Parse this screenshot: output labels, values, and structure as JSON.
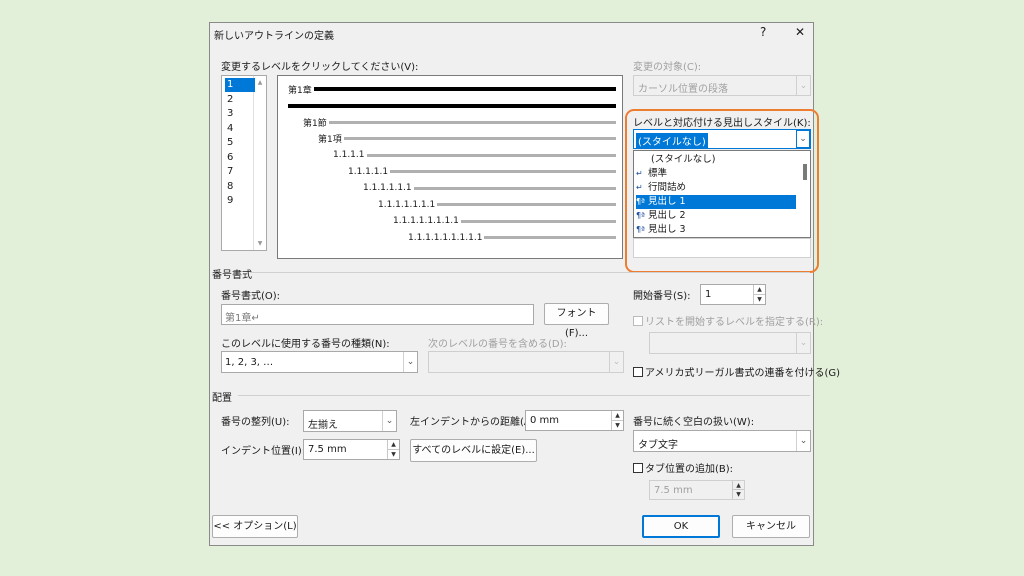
{
  "dialog": {
    "title": "新しいアウトラインの定義",
    "help_glyph": "?",
    "close_glyph": "✕"
  },
  "level_section": {
    "label": "変更するレベルをクリックしてください(V):",
    "levels": [
      "1",
      "2",
      "3",
      "4",
      "5",
      "6",
      "7",
      "8",
      "9"
    ],
    "selected": "1"
  },
  "preview": {
    "lines": [
      {
        "text": "第1章",
        "style": "thick"
      },
      {
        "text": "",
        "style": "thick"
      },
      {
        "text": "第1節",
        "style": "thin"
      },
      {
        "text": "第1項",
        "style": "thin"
      },
      {
        "text": "1.1.1.1",
        "style": "thin"
      },
      {
        "text": "1.1.1.1.1",
        "style": "thin"
      },
      {
        "text": "1.1.1.1.1.1",
        "style": "thin"
      },
      {
        "text": "1.1.1.1.1.1.1",
        "style": "thin"
      },
      {
        "text": "1.1.1.1.1.1.1.1",
        "style": "thin"
      },
      {
        "text": "1.1.1.1.1.1.1.1.1",
        "style": "thin"
      }
    ]
  },
  "apply_to": {
    "label": "変更の対象(C):",
    "value": "カーソル位置の段落"
  },
  "heading_style": {
    "label": "レベルと対応付ける見出しスタイル(K):",
    "value": "(スタイルなし)",
    "options": [
      {
        "icon": "",
        "text": "(スタイルなし)",
        "selected": false
      },
      {
        "icon": "↵",
        "text": "標準",
        "selected": false
      },
      {
        "icon": "↵",
        "text": "行間詰め",
        "selected": false
      },
      {
        "icon": "¶ª",
        "text": "見出し 1",
        "selected": true
      },
      {
        "icon": "¶ª",
        "text": "見出し 2",
        "selected": false
      },
      {
        "icon": "¶ª",
        "text": "見出し 3",
        "selected": false
      }
    ],
    "highlight_color": "#ed7d31",
    "selected_color": "#0078d7"
  },
  "number_format": {
    "section_title": "番号書式",
    "format_label": "番号書式(O):",
    "format_value": "第1章↵",
    "font_button": "フォント(F)...",
    "style_label": "このレベルに使用する番号の種類(N):",
    "style_value": "1, 2, 3, …",
    "include_label": "次のレベルの番号を含める(D):",
    "include_value": "",
    "start_label": "開始番号(S):",
    "start_value": "1",
    "restart_label": "リストを開始するレベルを指定する(R):",
    "restart_value": "",
    "legal_label": "アメリカ式リーガル書式の連番を付ける(G)"
  },
  "position": {
    "section_title": "配置",
    "alignment_label": "番号の整列(U):",
    "alignment_value": "左揃え",
    "left_indent_label": "左インデントからの距離(A):",
    "left_indent_value": "0 mm",
    "indent_label": "インデント位置(I):",
    "indent_value": "7.5 mm",
    "set_all_button": "すべてのレベルに設定(E)...",
    "follow_label": "番号に続く空白の扱い(W):",
    "follow_value": "タブ文字",
    "tab_stop_label": "タブ位置の追加(B):",
    "tab_stop_value": "7.5 mm"
  },
  "footer": {
    "options_button": "<< オプション(L)",
    "ok_button": "OK",
    "cancel_button": "キャンセル"
  }
}
